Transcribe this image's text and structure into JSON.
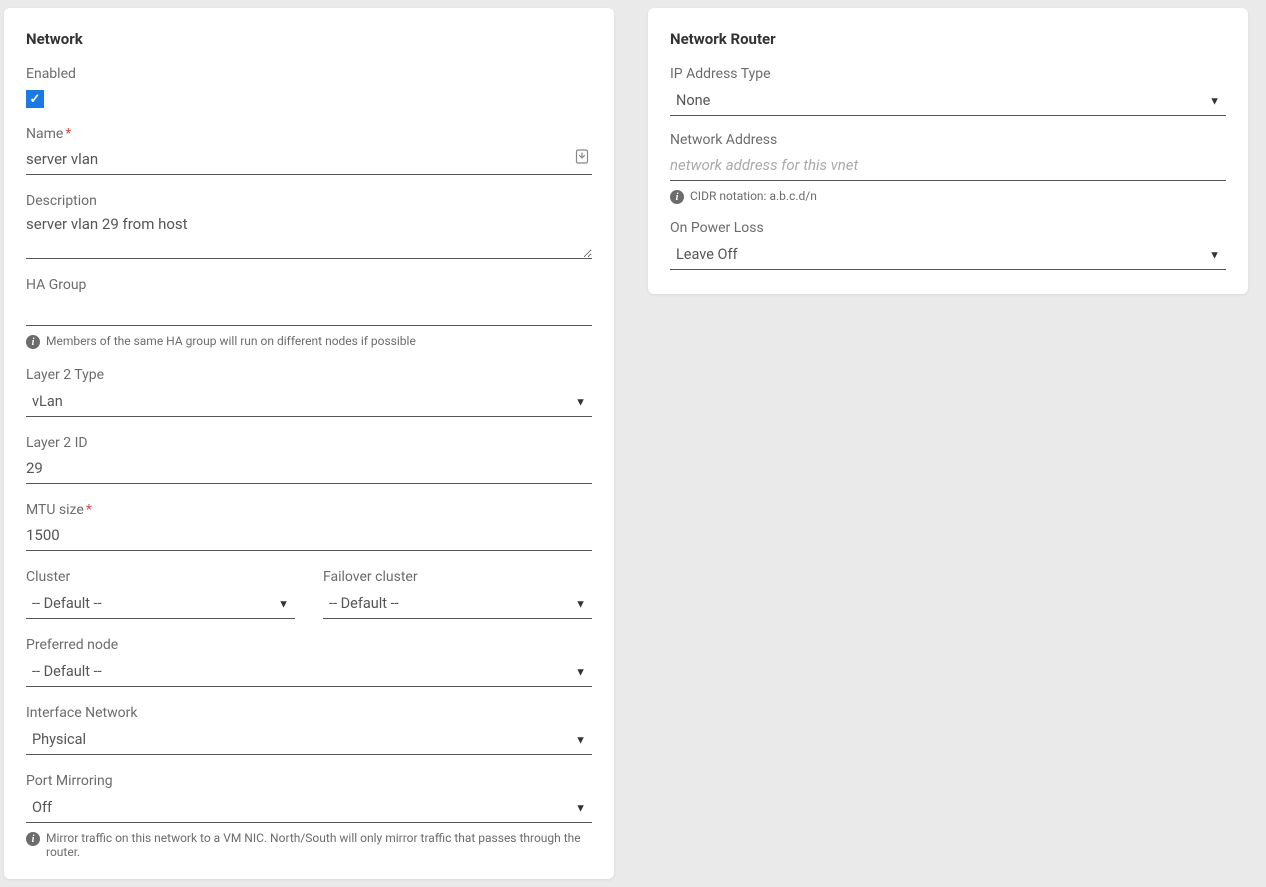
{
  "network": {
    "title": "Network",
    "enabled": {
      "label": "Enabled",
      "checked": true
    },
    "name": {
      "label": "Name",
      "value": "server vlan",
      "required": true
    },
    "description": {
      "label": "Description",
      "value": "server vlan 29 from host"
    },
    "ha_group": {
      "label": "HA Group",
      "value": "",
      "helper": "Members of the same HA group will run on different nodes if possible"
    },
    "layer2_type": {
      "label": "Layer 2 Type",
      "value": "vLan"
    },
    "layer2_id": {
      "label": "Layer 2 ID",
      "value": "29"
    },
    "mtu": {
      "label": "MTU size",
      "value": "1500",
      "required": true
    },
    "cluster": {
      "label": "Cluster",
      "value": "-- Default --"
    },
    "failover_cluster": {
      "label": "Failover cluster",
      "value": "-- Default --"
    },
    "preferred_node": {
      "label": "Preferred node",
      "value": "-- Default --"
    },
    "interface_network": {
      "label": "Interface Network",
      "value": "Physical"
    },
    "port_mirroring": {
      "label": "Port Mirroring",
      "value": "Off",
      "helper": "Mirror traffic on this network to a VM NIC. North/South will only mirror traffic that passes through the router."
    }
  },
  "router": {
    "title": "Network Router",
    "ip_type": {
      "label": "IP Address Type",
      "value": "None"
    },
    "net_addr": {
      "label": "Network Address",
      "value": "",
      "placeholder": "network address for this vnet",
      "helper": "CIDR notation: a.b.c.d/n"
    },
    "power_loss": {
      "label": "On Power Loss",
      "value": "Leave Off"
    }
  }
}
